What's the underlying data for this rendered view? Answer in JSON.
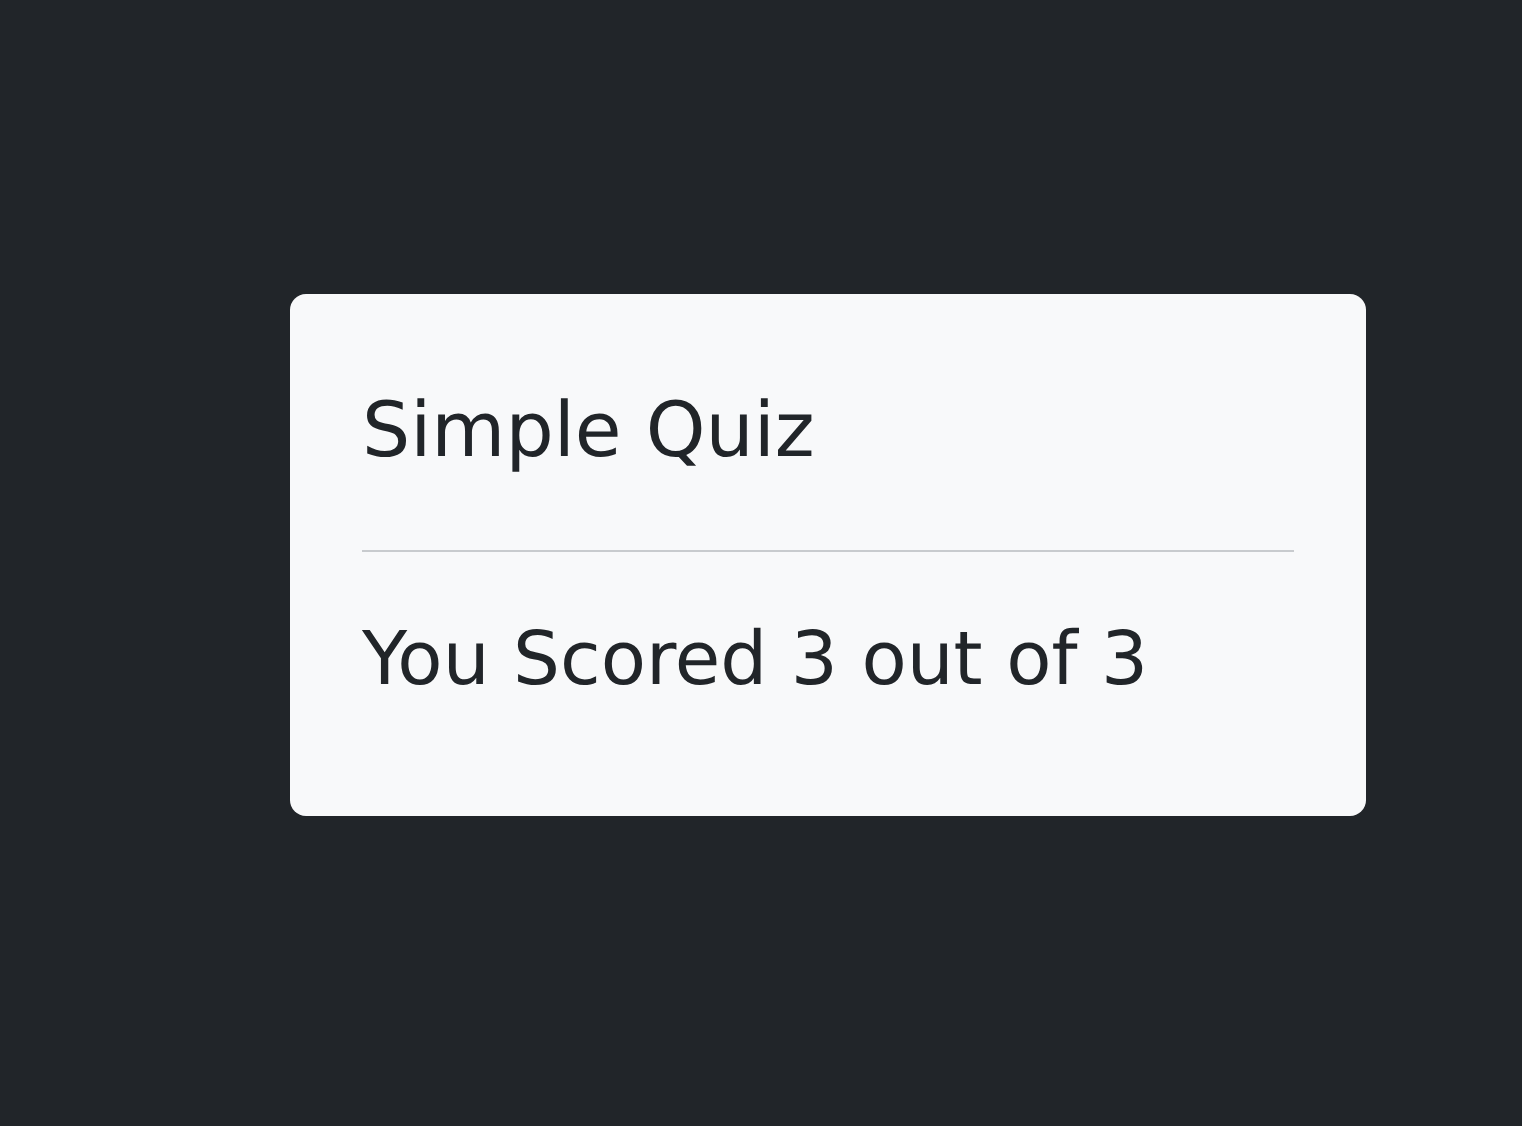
{
  "quiz": {
    "title": "Simple Quiz",
    "result": "You Scored 3 out of 3"
  }
}
